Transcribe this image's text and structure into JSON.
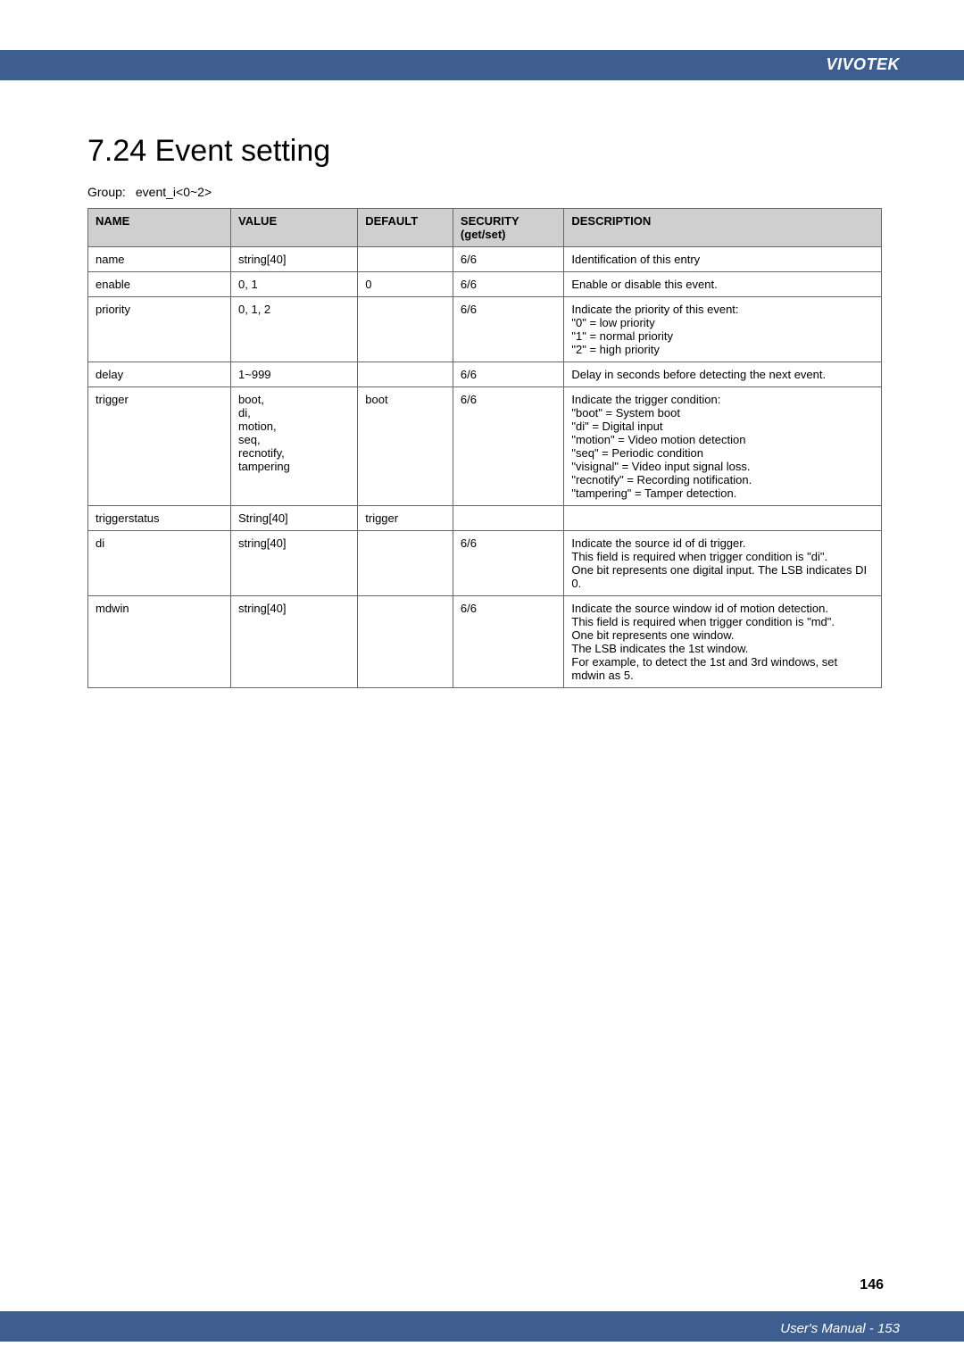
{
  "header": {
    "brand": "VIVOTEK"
  },
  "section": {
    "title": "7.24 Event setting",
    "group_label": "Group:",
    "group_value": "event_i<0~2>"
  },
  "table": {
    "headers": {
      "name": "NAME",
      "value": "VALUE",
      "default": "DEFAULT",
      "security": "SECURITY (get/set)",
      "description": "DESCRIPTION"
    },
    "rows": [
      {
        "name": "name",
        "value": "string[40]",
        "default": "",
        "security": "6/6",
        "description": "Identification of this entry"
      },
      {
        "name": "enable",
        "value": "0, 1",
        "default": "0",
        "security": "6/6",
        "description": "Enable or disable this event."
      },
      {
        "name": "priority",
        "value": "0, 1, 2",
        "default": "",
        "security": "6/6",
        "description": "Indicate the priority of this event:\n\"0\" = low priority\n\"1\" = normal priority\n\"2\" = high priority"
      },
      {
        "name": "delay",
        "value": "1~999",
        "default": "",
        "security": "6/6",
        "description": "Delay in seconds before detecting the next event."
      },
      {
        "name": "trigger",
        "value": "boot,\ndi,\nmotion,\nseq,\nrecnotify,\ntampering",
        "default": "boot",
        "security": "6/6",
        "description": "Indicate the trigger condition:\n\"boot\" = System boot\n\"di\" = Digital input\n\"motion\" = Video motion detection\n\"seq\" = Periodic condition\n\"visignal\" = Video input signal loss.\n\"recnotify\" = Recording notification.\n\"tampering\" = Tamper detection."
      },
      {
        "name": "triggerstatus",
        "value": "String[40]",
        "default": "trigger",
        "security": "",
        "description": ""
      },
      {
        "name": "di",
        "value": "string[40]",
        "default": "",
        "security": "6/6",
        "description": "Indicate the source id of di trigger.\nThis field is required when trigger condition is \"di\".\nOne bit represents one digital input. The LSB indicates DI 0."
      },
      {
        "name": "mdwin",
        "value": "string[40]",
        "default": "",
        "security": "6/6",
        "description": "Indicate the source window id of motion detection.\nThis field is required when trigger condition is \"md\".\nOne bit represents one window.\nThe LSB indicates the 1st window.\nFor example, to detect the 1st and 3rd windows, set mdwin as 5."
      }
    ]
  },
  "footer": {
    "page_number": "146",
    "manual": "User's Manual - 153"
  }
}
